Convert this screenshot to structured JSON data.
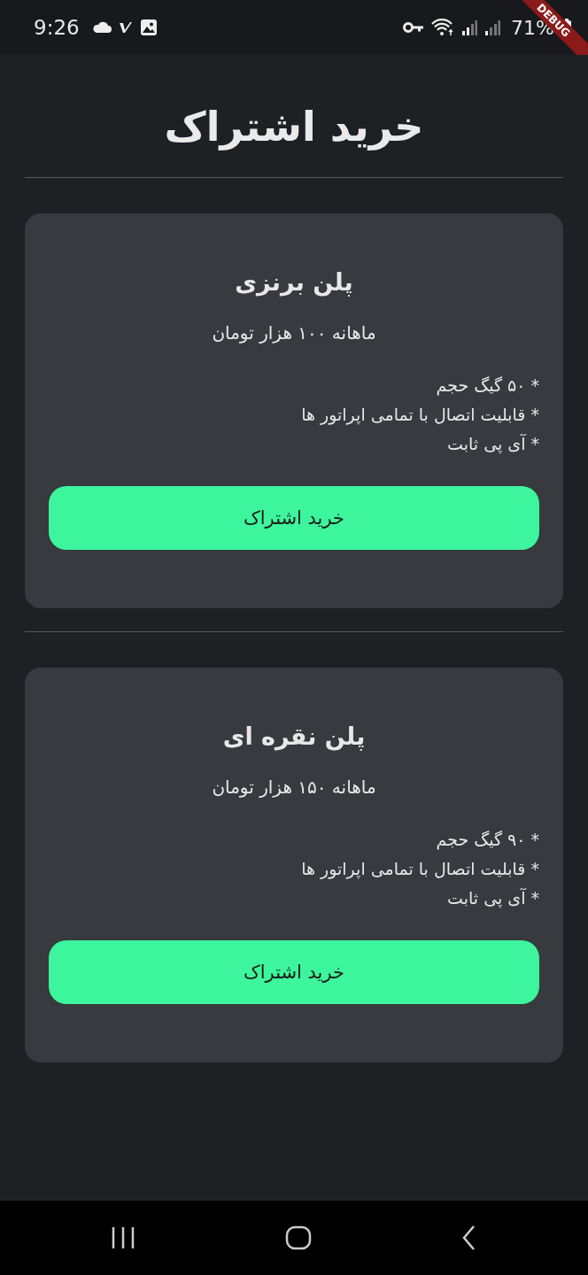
{
  "status_bar": {
    "time": "9:26",
    "battery": "71%"
  },
  "debug_banner": "DEBUG",
  "title": "خرید اشتراک",
  "plans": [
    {
      "name": "پلن برنزی",
      "price": "ماهانه ۱۰۰ هزار تومان",
      "features": [
        "* ۵۰ گیگ حجم",
        "* قابلیت اتصال با تمامی اپراتور ها",
        "* آی پی ثابت"
      ],
      "button": "خرید اشتراک"
    },
    {
      "name": "پلن نقره ای",
      "price": "ماهانه ۱۵۰ هزار تومان",
      "features": [
        "* ۹۰ گیگ حجم",
        "* قابلیت اتصال با تمامی اپراتور ها",
        "* آی پی ثابت"
      ],
      "button": "خرید اشتراک"
    }
  ]
}
